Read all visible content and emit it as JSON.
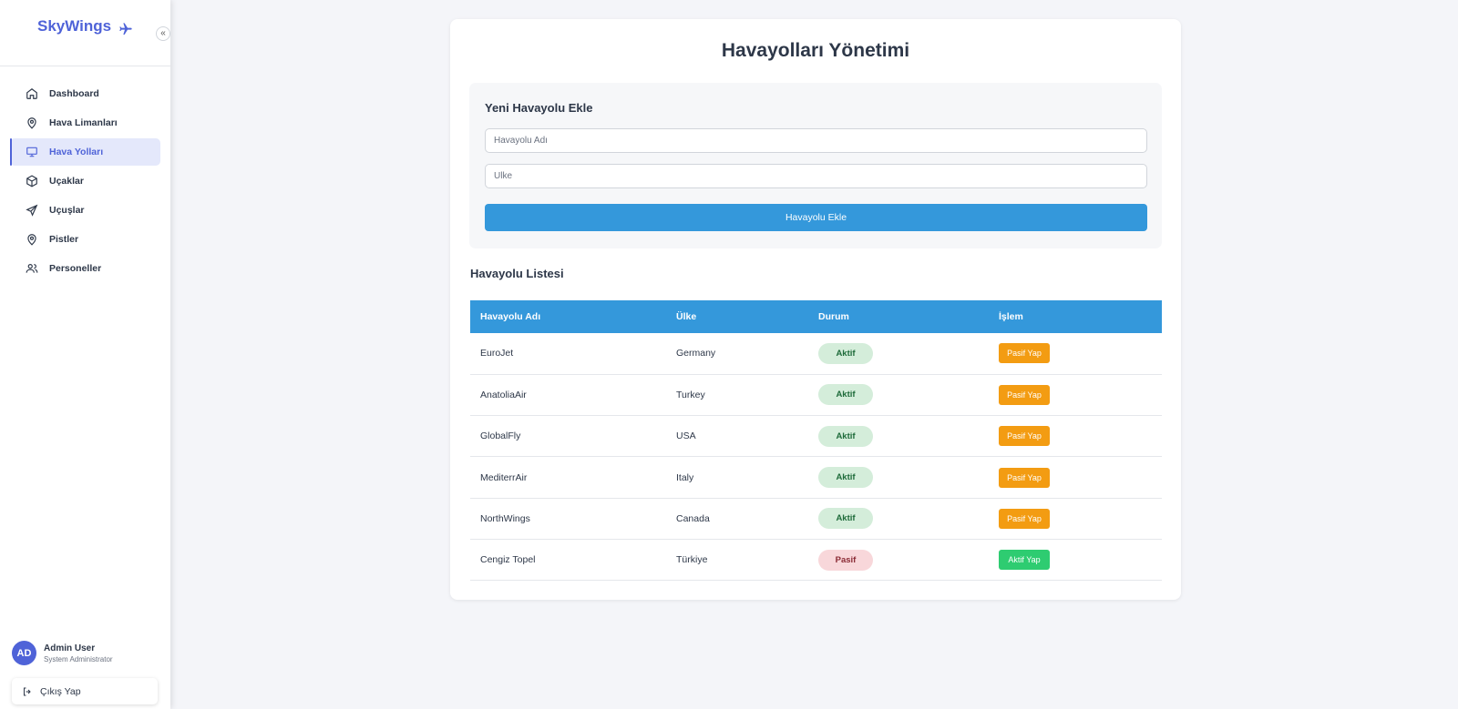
{
  "brand": {
    "name": "SkyWings"
  },
  "sidebar": {
    "collapse_glyph": "«",
    "items": [
      {
        "label": "Dashboard",
        "icon": "home-icon"
      },
      {
        "label": "Hava Limanları",
        "icon": "map-pin-icon"
      },
      {
        "label": "Hava Yolları",
        "icon": "monitor-icon",
        "active": true
      },
      {
        "label": "Uçaklar",
        "icon": "box-icon"
      },
      {
        "label": "Uçuşlar",
        "icon": "send-icon"
      },
      {
        "label": "Pistler",
        "icon": "map-pin-icon"
      },
      {
        "label": "Personeller",
        "icon": "users-icon"
      }
    ],
    "user": {
      "initials": "AD",
      "name": "Admin User",
      "role": "System Administrator"
    },
    "logout_label": "Çıkış Yap"
  },
  "main": {
    "title": "Havayolları Yönetimi",
    "form": {
      "title": "Yeni Havayolu Ekle",
      "name_placeholder": "Havayolu Adı",
      "country_placeholder": "Ulke",
      "submit_label": "Havayolu Ekle"
    },
    "list": {
      "title": "Havayolu Listesi",
      "columns": [
        "Havayolu Adı",
        "Ülke",
        "Durum",
        "İşlem"
      ],
      "rows": [
        {
          "name": "EuroJet",
          "country": "Germany",
          "status": "Aktif",
          "action": "Pasif Yap"
        },
        {
          "name": "AnatoliaAir",
          "country": "Turkey",
          "status": "Aktif",
          "action": "Pasif Yap"
        },
        {
          "name": "GlobalFly",
          "country": "USA",
          "status": "Aktif",
          "action": "Pasif Yap"
        },
        {
          "name": "MediterrAir",
          "country": "Italy",
          "status": "Aktif",
          "action": "Pasif Yap"
        },
        {
          "name": "NorthWings",
          "country": "Canada",
          "status": "Aktif",
          "action": "Pasif Yap"
        },
        {
          "name": "Cengiz Topel",
          "country": "Türkiye",
          "status": "Pasif",
          "action": "Aktif Yap"
        }
      ]
    }
  },
  "colors": {
    "accent": "#4f63d8",
    "primary": "#3498db",
    "warning": "#f39c12",
    "success": "#2ecc71"
  }
}
